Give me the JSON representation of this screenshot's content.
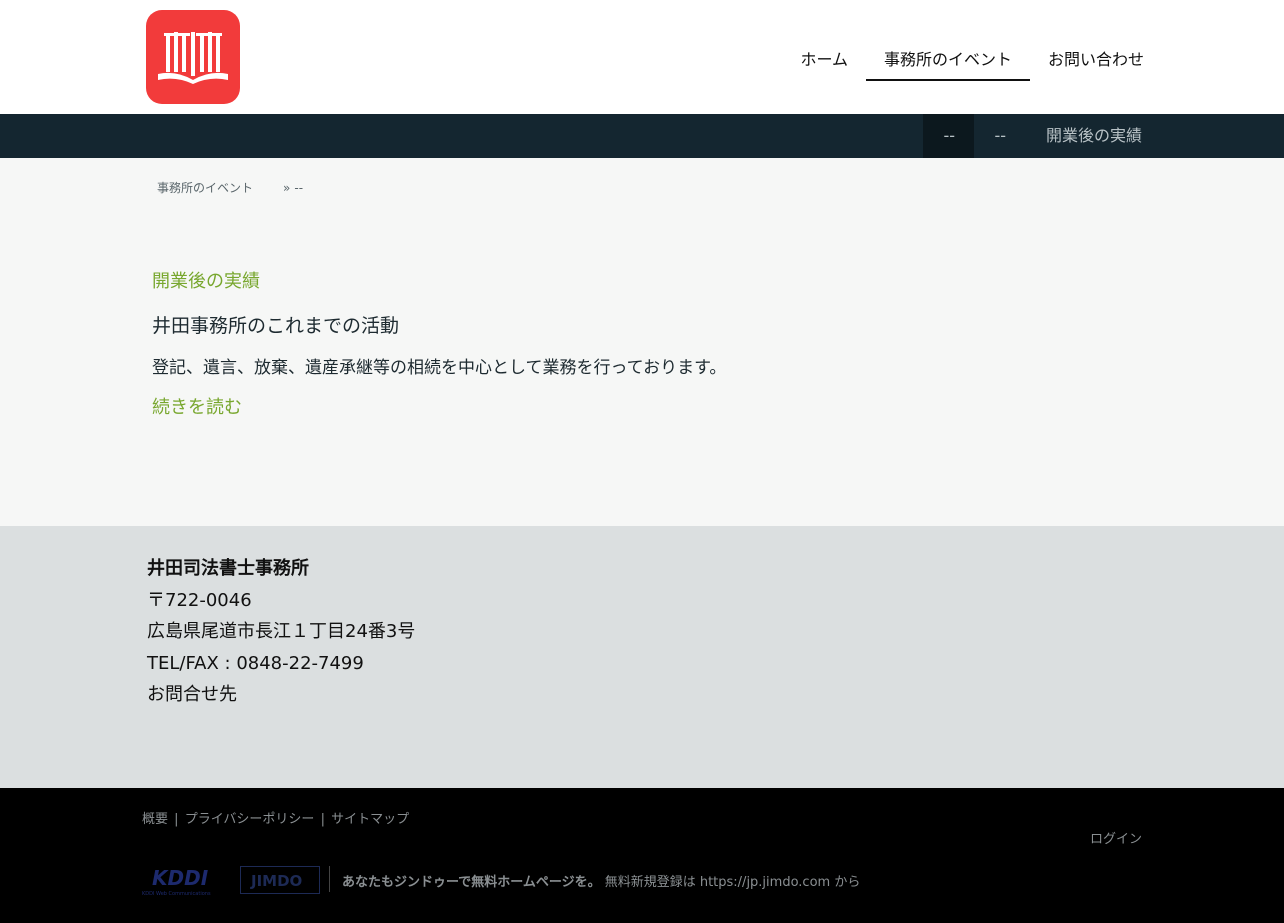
{
  "header": {
    "logo_icon": "open-book-icon",
    "brand_color": "#f23b3b",
    "nav": [
      {
        "label": "ホーム"
      },
      {
        "label": "事務所のイベント"
      },
      {
        "label": "お問い合わせ"
      }
    ],
    "active_nav": "事務所のイベント"
  },
  "subnav": {
    "items": [
      {
        "label": "--"
      },
      {
        "label": "--"
      },
      {
        "label": "開業後の実績"
      }
    ]
  },
  "breadcrumb": {
    "parent": "事務所のイベント",
    "separator": "»",
    "current": "--"
  },
  "main": {
    "section_title": "開業後の実績",
    "post_title": "井田事務所のこれまでの活動",
    "post_body": "登記、遺言、放棄、遺産承継等の相続を中心として業務を行っております。",
    "read_more": "続きを読む",
    "accent_color": "#78a72e"
  },
  "info": {
    "office_name": "井田司法書士事務所",
    "postal": "〒722-0046",
    "address": "広島県尾道市長江１丁目24番3号",
    "tel": "TEL/FAX : 0848-22-7499",
    "contact": "お問合せ先"
  },
  "footer": {
    "links": [
      "概要",
      "プライバシーポリシー",
      "サイトマップ"
    ],
    "link_separator": "|",
    "login": "ログイン",
    "promo_strong": "あなたもジンドゥーで無料ホームページを。",
    "promo_text": " 無料新規登録は https://jp.jimdo.com から",
    "kddi_logo": "KDDI",
    "kddi_sub": "KDDI Web Communications",
    "jimdo_logo": "JIMDO"
  }
}
